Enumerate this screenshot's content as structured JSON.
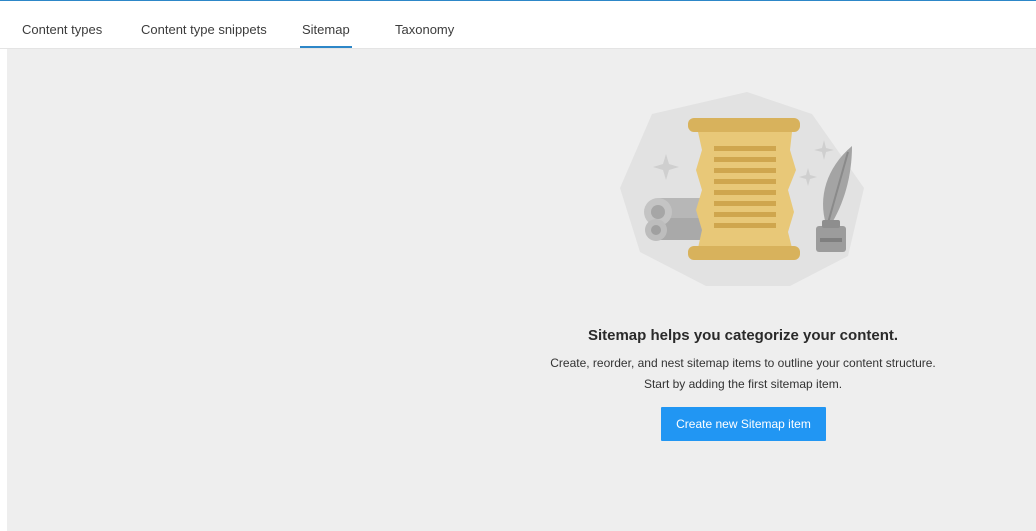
{
  "tabs": [
    {
      "label": "Content types",
      "active": false
    },
    {
      "label": "Content type snippets",
      "active": false
    },
    {
      "label": "Sitemap",
      "active": true
    },
    {
      "label": "Taxonomy",
      "active": false
    }
  ],
  "empty_state": {
    "illustration_icon": "scroll-quill-illustration-icon",
    "title": "Sitemap helps you categorize your content.",
    "description_line1": "Create, reorder, and nest sitemap items to outline your content structure.",
    "description_line2": "Start by adding the first sitemap item.",
    "button_label": "Create new Sitemap item"
  },
  "colors": {
    "accent": "#2d87c8",
    "button": "#2196f3",
    "canvas": "#eeeeee",
    "scroll": "#e3c270"
  }
}
